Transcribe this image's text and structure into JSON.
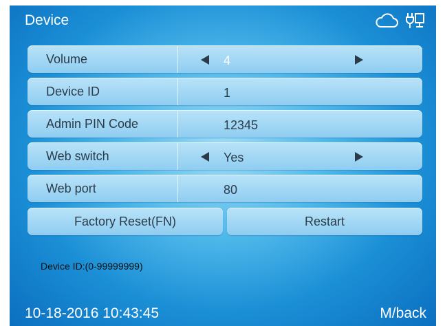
{
  "header": {
    "title": "Device",
    "icons": [
      "cloud-icon",
      "network-icon"
    ]
  },
  "rows": [
    {
      "label": "Volume",
      "value": "4",
      "has_arrows": true
    },
    {
      "label": "Device ID",
      "value": "1",
      "has_arrows": false
    },
    {
      "label": "Admin PIN Code",
      "value": "12345",
      "has_arrows": false
    },
    {
      "label": "Web switch",
      "value": "Yes",
      "has_arrows": true
    },
    {
      "label": "Web port",
      "value": "80",
      "has_arrows": false
    }
  ],
  "buttons": {
    "factory_reset": "Factory Reset(FN)",
    "restart": "Restart"
  },
  "hint": "Device ID:(0-99999999)",
  "footer": {
    "datetime": "10-18-2016 10:43:45",
    "back": "M/back"
  },
  "colors": {
    "accent": "#1b8fd6",
    "row_bg": "#a8daf5",
    "text_dark": "#2b3b4a",
    "text_light": "#ffffff"
  }
}
